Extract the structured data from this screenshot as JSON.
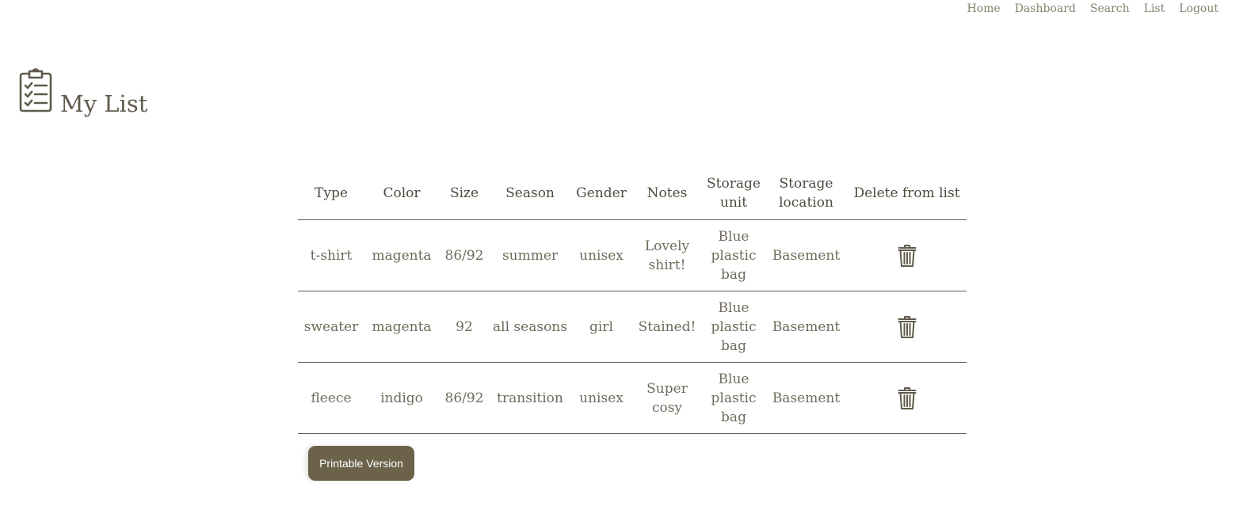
{
  "nav": {
    "items": [
      {
        "label": "Home"
      },
      {
        "label": "Dashboard"
      },
      {
        "label": "Search"
      },
      {
        "label": "List"
      },
      {
        "label": "Logout"
      }
    ]
  },
  "header": {
    "icon": "clipboard-checklist-icon",
    "title": "My List"
  },
  "table": {
    "columns": [
      "Type",
      "Color",
      "Size",
      "Season",
      "Gender",
      "Notes",
      "Storage unit",
      "Storage location",
      "Delete from list"
    ],
    "delete_icon": "trash-icon",
    "rows": [
      {
        "type": "t-shirt",
        "color": "magenta",
        "size": "86/92",
        "season": "summer",
        "gender": "unisex",
        "notes": "Lovely shirt!",
        "storage_unit": "Blue plastic bag",
        "storage_location": "Basement"
      },
      {
        "type": "sweater",
        "color": "magenta",
        "size": "92",
        "season": "all seasons",
        "gender": "girl",
        "notes": "Stained!",
        "storage_unit": "Blue plastic bag",
        "storage_location": "Basement"
      },
      {
        "type": "fleece",
        "color": "indigo",
        "size": "86/92",
        "season": "transition",
        "gender": "unisex",
        "notes": "Super cosy",
        "storage_unit": "Blue plastic bag",
        "storage_location": "Basement"
      }
    ]
  },
  "actions": {
    "print_label": "Printable Version"
  },
  "colors": {
    "text": "#5f5a4b",
    "nav": "#85826f",
    "button_bg": "#6b6249",
    "button_text": "#ffffff"
  }
}
